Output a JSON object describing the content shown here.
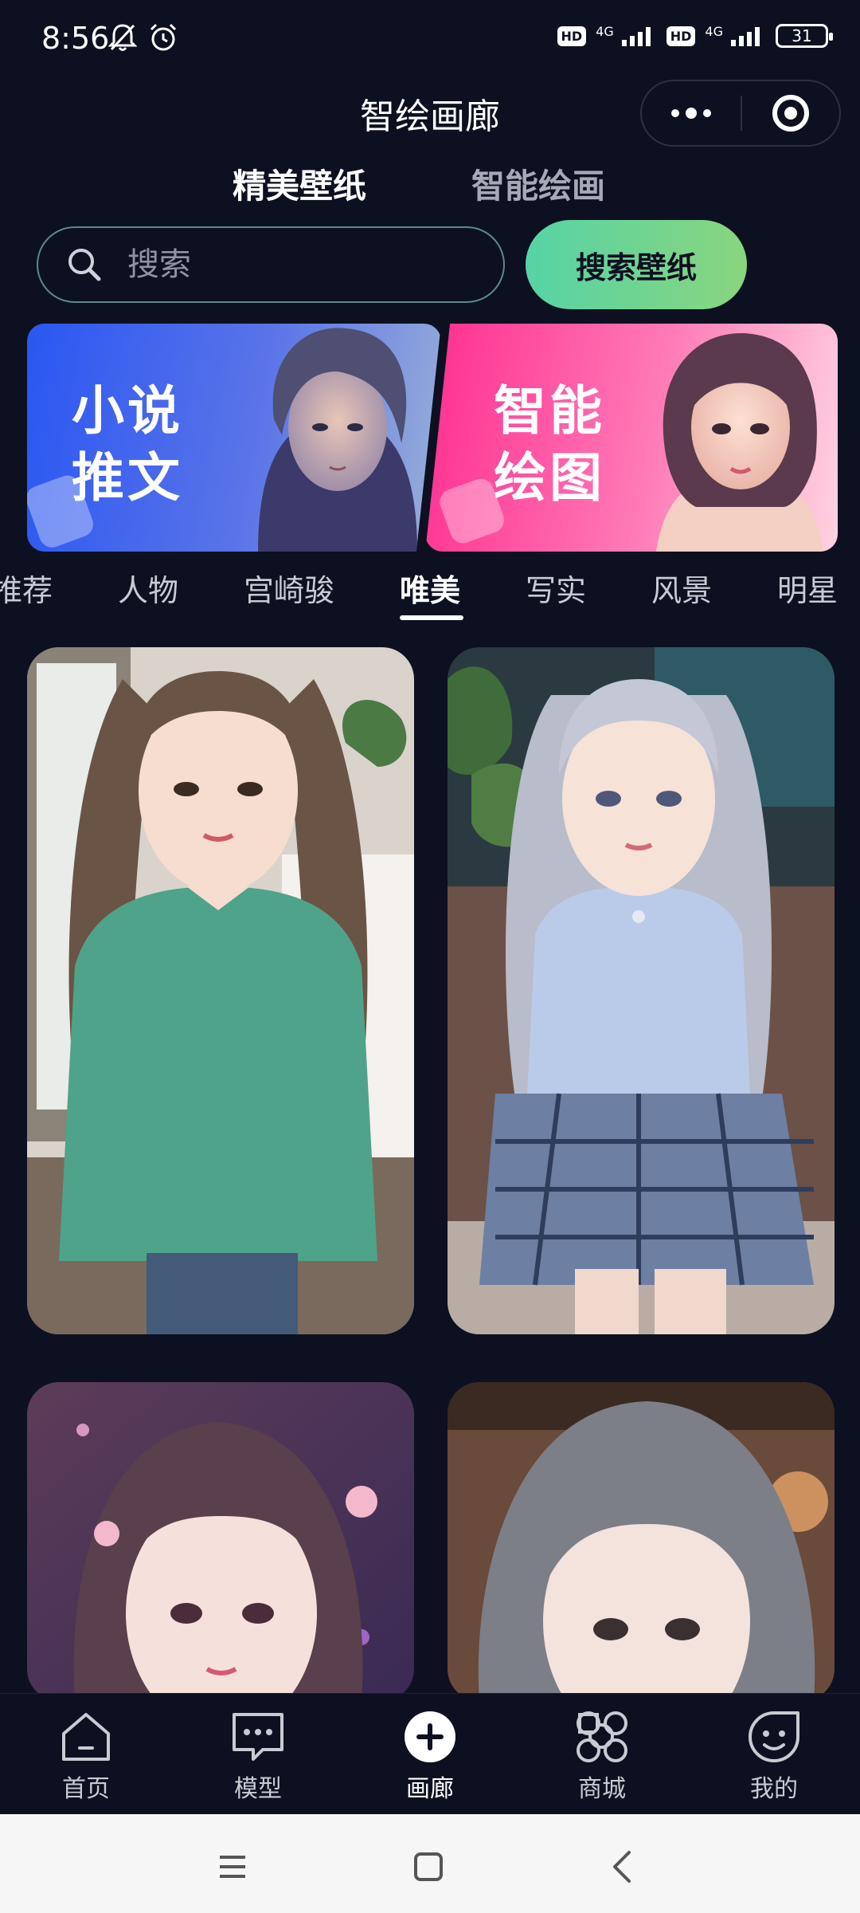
{
  "status_bar": {
    "time": "8:56",
    "network_1": "4G",
    "network_2": "4G",
    "battery": "31"
  },
  "header": {
    "title": "智绘画廊"
  },
  "top_tabs": [
    {
      "label": "精美壁纸",
      "active": true
    },
    {
      "label": "智能绘画",
      "active": false
    }
  ],
  "search": {
    "placeholder": "搜索",
    "button_label": "搜索壁纸"
  },
  "banners": [
    {
      "text_line1": "小说",
      "text_line2": "推文"
    },
    {
      "text_line1": "智能",
      "text_line2": "绘图"
    }
  ],
  "categories": [
    "推荐",
    "人物",
    "宫崎骏",
    "唯美",
    "写实",
    "风景",
    "明星"
  ],
  "active_category": "唯美",
  "bottom_nav": [
    {
      "label": "首页",
      "icon": "home-icon"
    },
    {
      "label": "模型",
      "icon": "chat-bubble-icon"
    },
    {
      "label": "画廊",
      "icon": "plus-circle-icon",
      "active": true
    },
    {
      "label": "商城",
      "icon": "grid-apps-icon"
    },
    {
      "label": "我的",
      "icon": "smile-face-icon"
    }
  ],
  "colors": {
    "background": "#0d1020",
    "accent_gradient_start": "#55d4a6",
    "accent_gradient_end": "#8ad57e"
  }
}
